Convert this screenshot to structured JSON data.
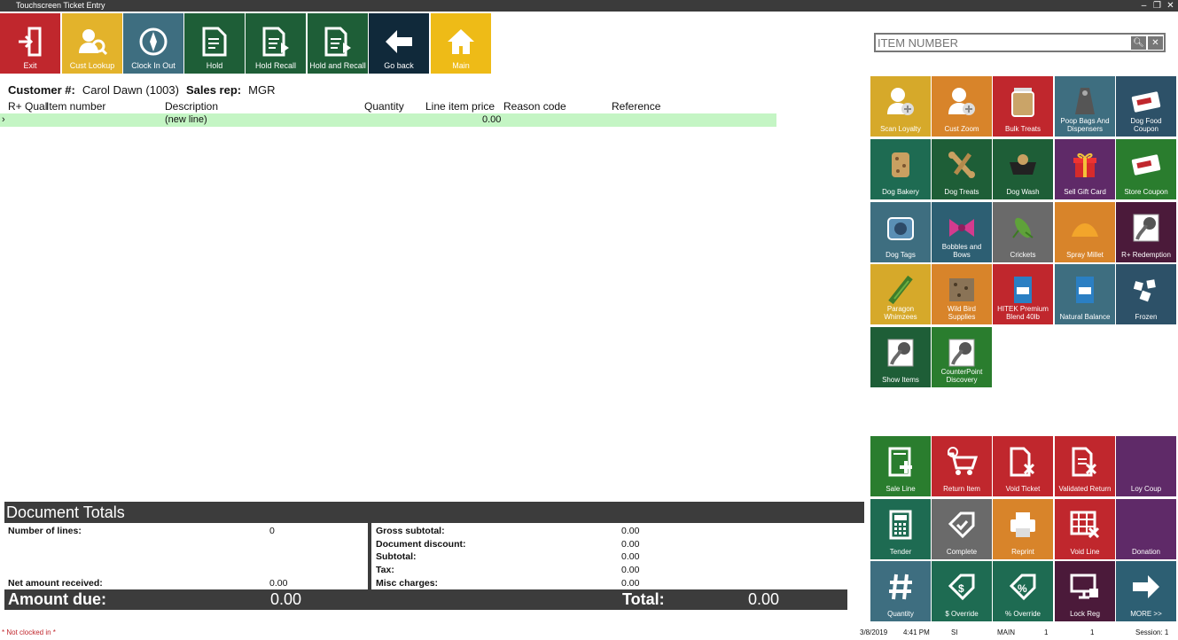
{
  "window": {
    "title": "Touchscreen Ticket Entry",
    "controls": [
      "–",
      "❐",
      "✕"
    ]
  },
  "toolbar": [
    {
      "name": "exit-button",
      "label": "Exit",
      "color": "#c0272d",
      "icon": "exit-door-icon"
    },
    {
      "name": "cust-lookup-button",
      "label": "Cust Lookup",
      "color": "#e3b32b",
      "icon": "user-search-icon"
    },
    {
      "name": "clock-in-out-button",
      "label": "Clock In Out",
      "color": "#3e6e80",
      "icon": "compass-icon"
    },
    {
      "name": "hold-button",
      "label": "Hold",
      "color": "#1e5e37",
      "icon": "document-hold-icon"
    },
    {
      "name": "hold-recall-button",
      "label": "Hold Recall",
      "color": "#1e5e37",
      "icon": "document-recall-icon"
    },
    {
      "name": "hold-and-recall-button",
      "label": "Hold and Recall",
      "color": "#1e5e37",
      "icon": "document-recall-icon"
    },
    {
      "name": "go-back-button",
      "label": "Go back",
      "color": "#10293a",
      "icon": "arrow-left-icon"
    },
    {
      "name": "main-button",
      "label": "Main",
      "color": "#eebb17",
      "icon": "home-icon"
    }
  ],
  "customer": {
    "label": "Customer #:",
    "value": "Carol Dawn (1003)",
    "sales_rep_label": "Sales rep:",
    "sales_rep": "MGR"
  },
  "columns": [
    "R+ Qual",
    "Item number",
    "Description",
    "Quantity",
    "Line item price",
    "Reason code",
    "Reference"
  ],
  "new_line": {
    "marker": "›",
    "description": "(new line)",
    "price": "0.00"
  },
  "search": {
    "placeholder": "ITEM NUMBER"
  },
  "tiles": [
    {
      "label": "Scan Loyalty",
      "color": "#d6a92a",
      "icon": "user-add-icon"
    },
    {
      "label": "Cust Zoom",
      "color": "#d8842a",
      "icon": "user-add-icon"
    },
    {
      "label": "Bulk Treats",
      "color": "#c0272d",
      "icon": "jar-icon"
    },
    {
      "label": "Poop Bags And Dispensers",
      "color": "#3e6e80",
      "icon": "bag-dispenser-icon"
    },
    {
      "label": "Dog Food Coupon",
      "color": "#2d5168",
      "icon": "coupon-icon"
    },
    {
      "label": "Dog Bakery",
      "color": "#1e6b52",
      "icon": "cookie-icon"
    },
    {
      "label": "Dog Treats",
      "color": "#1e5e37",
      "icon": "bone-icon"
    },
    {
      "label": "Dog Wash",
      "color": "#1e5e37",
      "icon": "tub-icon"
    },
    {
      "label": "Sell Gift Card",
      "color": "#5f2a68",
      "icon": "gift-icon"
    },
    {
      "label": "Store Coupon",
      "color": "#2a7d2e",
      "icon": "coupon-icon"
    },
    {
      "label": "Dog Tags",
      "color": "#3e6e80",
      "icon": "tag-icon"
    },
    {
      "label": "Bobbles and Bows",
      "color": "#2d5f73",
      "icon": "bow-icon"
    },
    {
      "label": "Crickets",
      "color": "#6a6a6a",
      "icon": "cricket-icon"
    },
    {
      "label": "Spray Millet",
      "color": "#d8842a",
      "icon": "millet-icon"
    },
    {
      "label": "R+ Redemption",
      "color": "#4b1a3a",
      "icon": "photo-placeholder-icon"
    },
    {
      "label": "Paragon Whimzees",
      "color": "#d6a92a",
      "icon": "chew-icon"
    },
    {
      "label": "Wild Bird Supplies",
      "color": "#d8842a",
      "icon": "seed-bag-icon"
    },
    {
      "label": "HITEK Premium Blend 40lb",
      "color": "#c0272d",
      "icon": "food-bag-icon"
    },
    {
      "label": "Natural Balance",
      "color": "#3e6e80",
      "icon": "food-bag-icon"
    },
    {
      "label": "Frozen",
      "color": "#2d5168",
      "icon": "frozen-icon"
    },
    {
      "label": "Show Items",
      "color": "#1e5e37",
      "icon": "photo-placeholder-icon"
    },
    {
      "label": "CounterPoint Discovery",
      "color": "#2a7d2e",
      "icon": "photo-placeholder-icon"
    }
  ],
  "actions": [
    {
      "label": "Sale Line",
      "color": "#2a7d2e",
      "icon": "sale-line-icon"
    },
    {
      "label": "Return Item",
      "color": "#c0272d",
      "icon": "cart-return-icon"
    },
    {
      "label": "Void Ticket",
      "color": "#c0272d",
      "icon": "void-ticket-icon"
    },
    {
      "label": "Validated Return",
      "color": "#c0272d",
      "icon": "validated-return-icon"
    },
    {
      "label": "Loy Coup",
      "color": "#5f2a68",
      "icon": ""
    },
    {
      "label": "Tender",
      "color": "#1e6b52",
      "icon": "keypad-icon"
    },
    {
      "label": "Complete",
      "color": "#6a6a6a",
      "icon": "tag-check-icon"
    },
    {
      "label": "Reprint",
      "color": "#d8842a",
      "icon": "printer-icon"
    },
    {
      "label": "Void Line",
      "color": "#c0272d",
      "icon": "grid-x-icon"
    },
    {
      "label": "Donation",
      "color": "#5f2a68",
      "icon": ""
    },
    {
      "label": "Quantity",
      "color": "#3e6e80",
      "icon": "hash-icon"
    },
    {
      "label": "$ Override",
      "color": "#1e6b52",
      "icon": "dollar-tag-icon"
    },
    {
      "label": "% Override",
      "color": "#1e6b52",
      "icon": "percent-tag-icon"
    },
    {
      "label": "Lock Reg",
      "color": "#4b1a3a",
      "icon": "monitor-lock-icon"
    },
    {
      "label": "MORE >>",
      "color": "#2d5f73",
      "icon": "arrow-right-icon"
    }
  ],
  "totals": {
    "heading": "Document Totals",
    "num_lines_label": "Number of lines:",
    "num_lines": "0",
    "net_received_label": "Net amount received:",
    "net_received": "0.00",
    "gross_label": "Gross subtotal:",
    "gross": "0.00",
    "doc_discount_label": "Document discount:",
    "doc_discount": "0.00",
    "subtotal_label": "Subtotal:",
    "subtotal": "0.00",
    "tax_label": "Tax:",
    "tax": "0.00",
    "misc_label": "Misc charges:",
    "misc": "0.00",
    "amount_due_label": "Amount due:",
    "amount_due": "0.00",
    "total_label": "Total:",
    "total": "0.00"
  },
  "status": {
    "clock": "* Not clocked in *",
    "date": "3/8/2019",
    "time": "4:41 PM",
    "doc_type": "SI",
    "location": "MAIN",
    "station": "1",
    "drawer": "1",
    "session": "Session: 1"
  }
}
